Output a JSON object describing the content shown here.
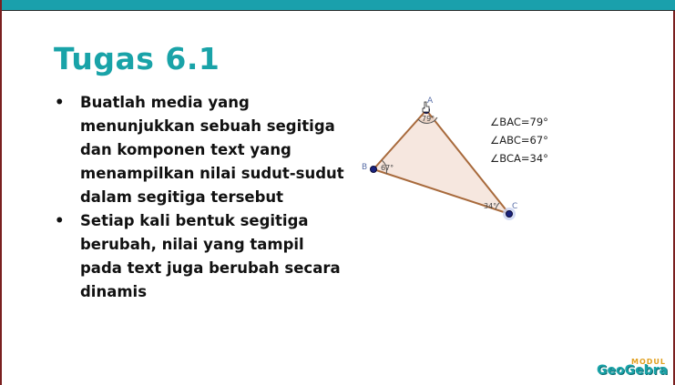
{
  "slide": {
    "title": "Tugas 6.1",
    "bullets": [
      "Buatlah media yang menunjukkan sebuah segitiga dan komponen text yang menampilkan nilai sudut-sudut dalam segitiga tersebut",
      "Setiap kali bentuk segitiga berubah, nilai yang tampil pada text juga berubah secara dinamis"
    ],
    "bullet_symbol": "•"
  },
  "figure": {
    "vertices": {
      "a": "A",
      "b": "B",
      "c": "C"
    },
    "angle_labels": {
      "a": "79°",
      "b": "67°",
      "c": "34°"
    },
    "readouts": [
      "∠BAC=79°",
      "∠ABC=67°",
      "∠BCA=34°"
    ],
    "colors": {
      "edge": "#a86a3c",
      "fill": "#f6e7df",
      "point": "#1a237e",
      "label": "#5a6fa8"
    }
  },
  "logo": {
    "top": "MODUL",
    "main": "GeoGebra"
  },
  "colors": {
    "accent": "#19a3a8",
    "border": "#7a1f1f"
  }
}
